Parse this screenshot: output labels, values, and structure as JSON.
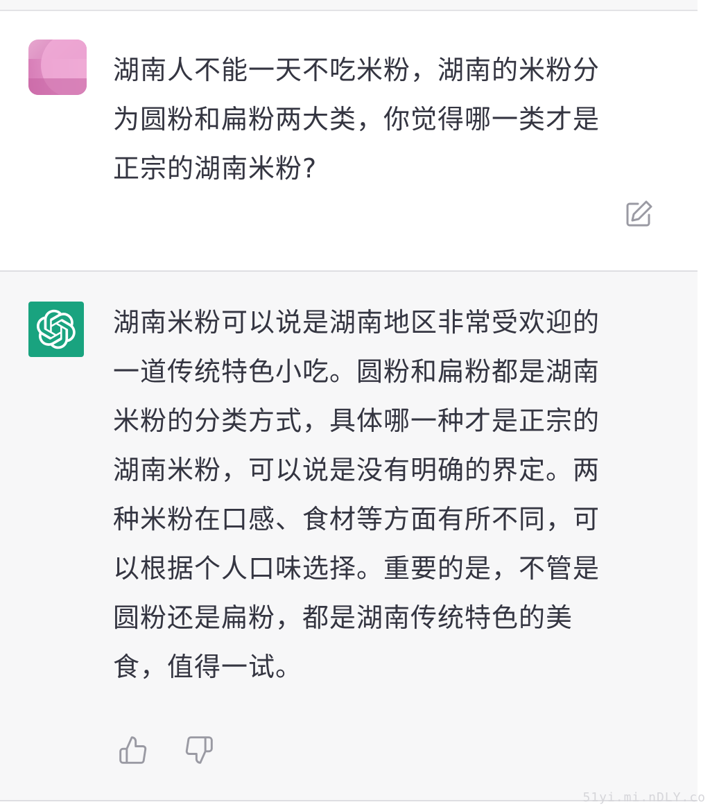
{
  "conversation": {
    "user_message": {
      "lines": [
        "湖南人不能一天不吃米粉，湖南的米粉分",
        "为圆粉和扁粉两大类，你觉得哪一类才是",
        "正宗的湖南米粉?"
      ],
      "avatar_icon": "user-avatar-blurred",
      "edit_icon": "edit-icon"
    },
    "assistant_message": {
      "lines": [
        "湖南米粉可以说是湖南地区非常受欢迎的",
        "一道传统特色小吃。圆粉和扁粉都是湖南",
        "米粉的分类方式，具体哪一种才是正宗的",
        "湖南米粉，可以说是没有明确的界定。两",
        "种米粉在口感、食材等方面有所不同，可",
        "以根据个人口味选择。重要的是，不管是",
        "圆粉还是扁粉，都是湖南传统特色的美",
        "食，值得一试。"
      ],
      "avatar_icon": "openai-logo-icon",
      "feedback_icons": [
        "thumbs-up-icon",
        "thumbs-down-icon"
      ]
    }
  },
  "watermark": "51yi.mi.nDLY.co",
  "colors": {
    "assistant_bg": "#f7f7f8",
    "user_bg": "#ffffff",
    "text": "#343541",
    "ai_avatar": "#19a37f",
    "icon": "#9a9aa3"
  }
}
